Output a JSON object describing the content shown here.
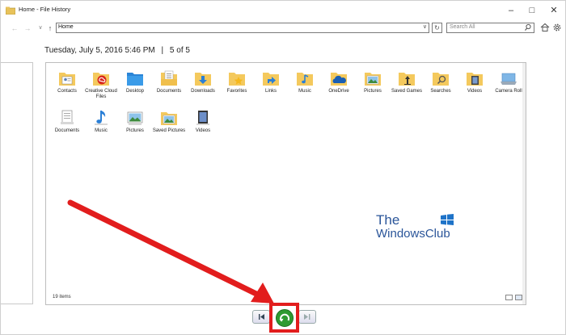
{
  "window": {
    "title": "Home - File History"
  },
  "nav": {
    "address": "Home",
    "search_placeholder": "Search All"
  },
  "snapshot": {
    "date": "Tuesday, July 5, 2016 5:46 PM",
    "separator": "|",
    "position": "5 of 5"
  },
  "files": [
    {
      "label": "Contacts",
      "icon": "contacts-folder"
    },
    {
      "label": "Creative Cloud Files",
      "icon": "creative-cloud-folder"
    },
    {
      "label": "Desktop",
      "icon": "desktop-folder"
    },
    {
      "label": "Documents",
      "icon": "documents-folder"
    },
    {
      "label": "Downloads",
      "icon": "downloads-folder"
    },
    {
      "label": "Favorites",
      "icon": "favorites-folder"
    },
    {
      "label": "Links",
      "icon": "links-folder"
    },
    {
      "label": "Music",
      "icon": "music-folder"
    },
    {
      "label": "OneDrive",
      "icon": "onedrive-folder"
    },
    {
      "label": "Pictures",
      "icon": "pictures-folder"
    },
    {
      "label": "Saved Games",
      "icon": "saved-games-folder"
    },
    {
      "label": "Searches",
      "icon": "searches-folder"
    },
    {
      "label": "Videos",
      "icon": "videos-folder"
    },
    {
      "label": "Camera Roll",
      "icon": "camera-roll-folder"
    },
    {
      "label": "Documents",
      "icon": "documents-library"
    },
    {
      "label": "Music",
      "icon": "music-library"
    },
    {
      "label": "Pictures",
      "icon": "pictures-library"
    },
    {
      "label": "Saved Pictures",
      "icon": "saved-pictures-folder"
    },
    {
      "label": "Videos",
      "icon": "videos-library"
    }
  ],
  "status": {
    "items": "19 items"
  },
  "watermark": {
    "line1": "The",
    "line2": "WindowsClub"
  },
  "colors": {
    "folder": "#f4c95d",
    "accent": "#2a5599",
    "restore": "#2e9a31",
    "highlight": "#e21d1d"
  }
}
